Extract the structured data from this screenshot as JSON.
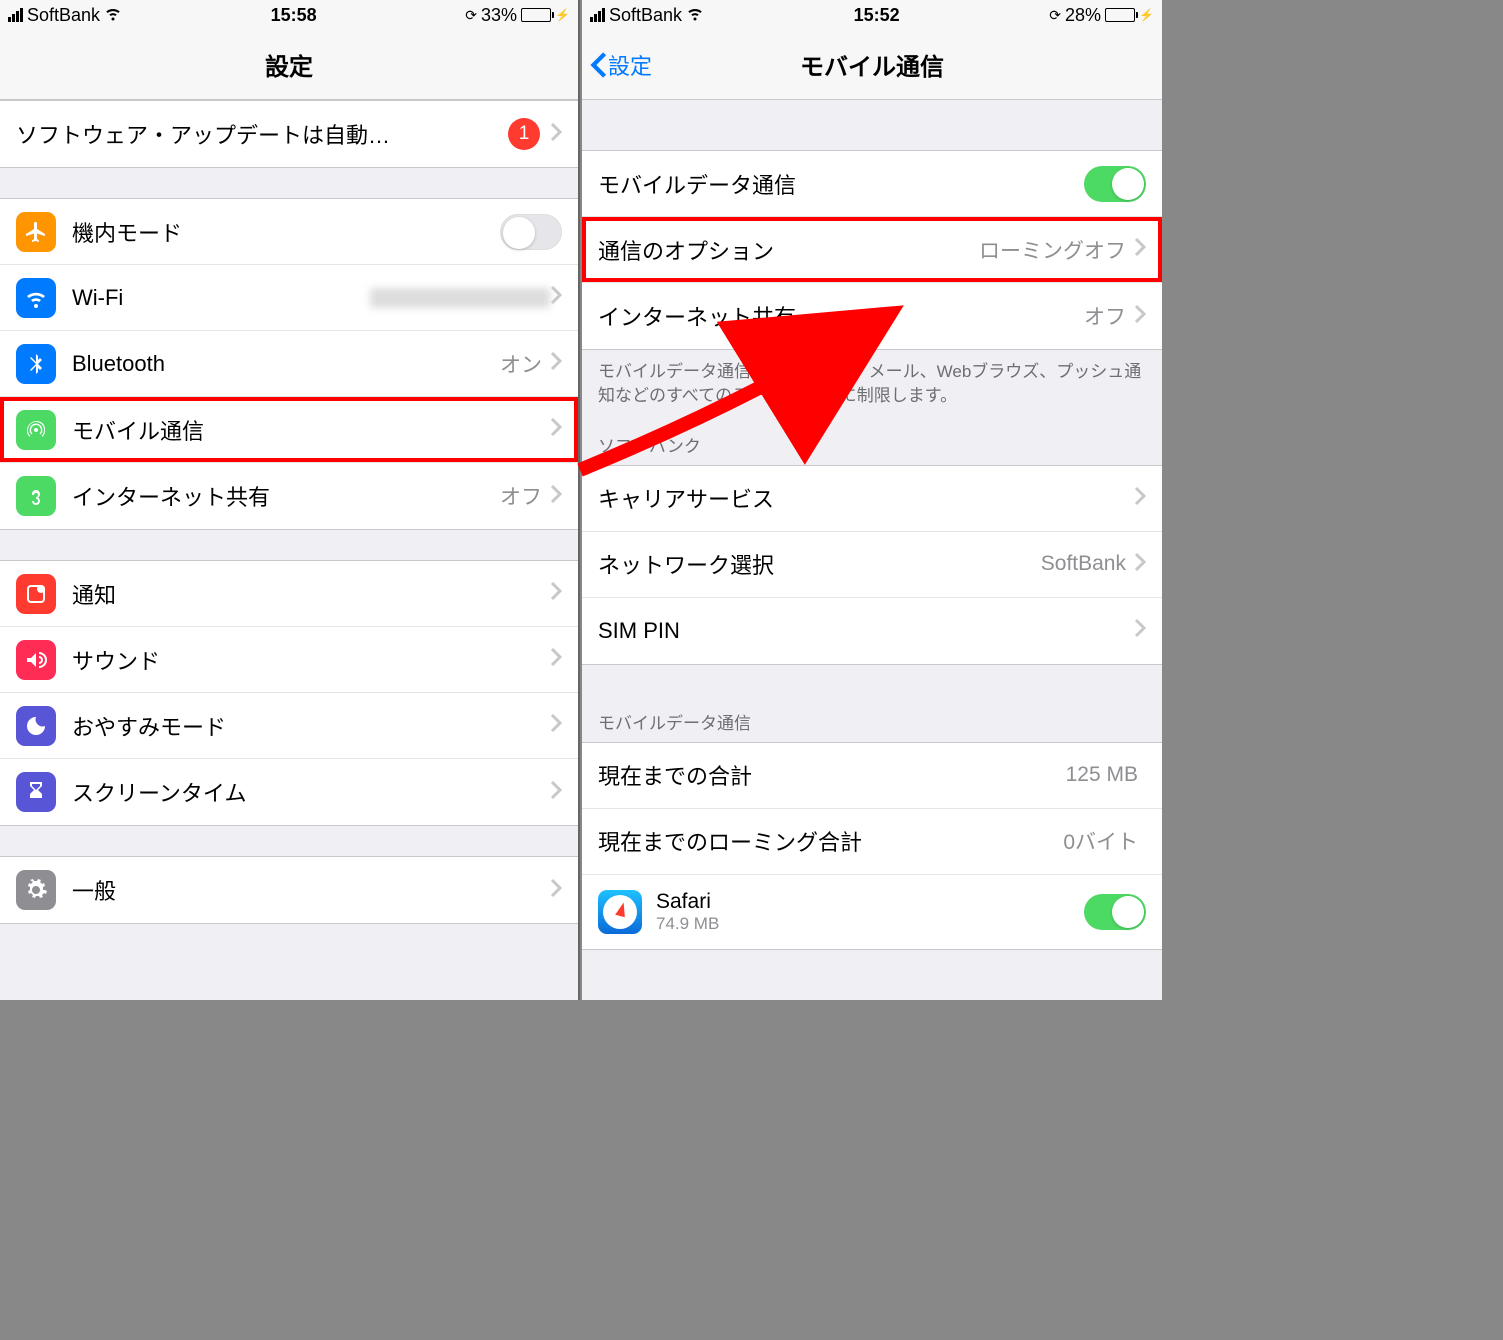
{
  "left": {
    "status": {
      "carrier": "SoftBank",
      "time": "15:58",
      "battery_pct": "33%",
      "battery_fill": "33%"
    },
    "nav": {
      "title": "設定"
    },
    "update": {
      "label": "ソフトウェア・アップデートは自動…",
      "badge": "1"
    },
    "airplane": {
      "label": "機内モード"
    },
    "wifi": {
      "label": "Wi-Fi"
    },
    "bluetooth": {
      "label": "Bluetooth",
      "value": "オン"
    },
    "cellular": {
      "label": "モバイル通信"
    },
    "hotspot": {
      "label": "インターネット共有",
      "value": "オフ"
    },
    "notifications": {
      "label": "通知"
    },
    "sound": {
      "label": "サウンド"
    },
    "dnd": {
      "label": "おやすみモード"
    },
    "screentime": {
      "label": "スクリーンタイム"
    },
    "general": {
      "label": "一般"
    }
  },
  "right": {
    "status": {
      "carrier": "SoftBank",
      "time": "15:52",
      "battery_pct": "28%",
      "battery_fill": "28%"
    },
    "nav": {
      "back": "設定",
      "title": "モバイル通信"
    },
    "mobiledata": {
      "label": "モバイルデータ通信"
    },
    "options": {
      "label": "通信のオプション",
      "value": "ローミングオフ"
    },
    "hotspot": {
      "label": "インターネット共有",
      "value": "オフ"
    },
    "footer1": "モバイルデータ通信をオフにして、メール、Webブラウズ、プッシュ通知などのすべてのデータをWi-Fiに制限します。",
    "header_softbank": "ソフトバンク",
    "carrier_svc": {
      "label": "キャリアサービス"
    },
    "network_sel": {
      "label": "ネットワーク選択",
      "value": "SoftBank"
    },
    "simpin": {
      "label": "SIM PIN"
    },
    "header_data": "モバイルデータ通信",
    "total": {
      "label": "現在までの合計",
      "value": "125 MB"
    },
    "roaming_total": {
      "label": "現在までのローミング合計",
      "value": "0バイト"
    },
    "safari": {
      "label": "Safari",
      "sub": "74.9 MB"
    }
  }
}
